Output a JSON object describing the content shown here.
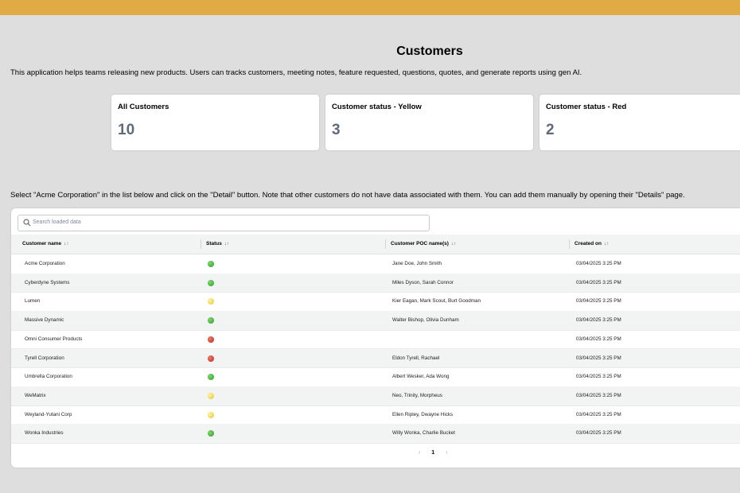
{
  "page": {
    "title": "Customers",
    "intro": "This application helps teams releasing new products. Users can tracks customers, meeting notes, feature requested, questions, quotes, and generate reports using gen AI.",
    "instructions": "Select \"Acme Corporation\" in the list below and click on the \"Detail\" button. Note that other customers do not have data associated with them. You can add them manually by opening their \"Details\" page."
  },
  "stats": [
    {
      "label": "All Customers",
      "value": "10"
    },
    {
      "label": "Customer status - Yellow",
      "value": "3"
    },
    {
      "label": "Customer status - Red",
      "value": "2"
    }
  ],
  "search": {
    "placeholder": "Search loaded data"
  },
  "table": {
    "columns": [
      {
        "label": "Customer name",
        "sort_icon": "↓↑"
      },
      {
        "label": "Status",
        "sort_icon": "↓↑"
      },
      {
        "label": "Customer POC name(s)",
        "sort_icon": "↓↑"
      },
      {
        "label": "Created on",
        "sort_icon": "↓↑"
      }
    ],
    "rows": [
      {
        "name": "Acme Corporation",
        "status": "green",
        "poc": "Jane Doe, John Smith",
        "created": "03/04/2025 3:25 PM"
      },
      {
        "name": "Cyberdyne Systems",
        "status": "green",
        "poc": "Miles Dyson, Sarah Connor",
        "created": "03/04/2025 3:25 PM"
      },
      {
        "name": "Lumen",
        "status": "yellow",
        "poc": "Kier Eagan, Mark Scout, Burt Goodman",
        "created": "03/04/2025 3:25 PM"
      },
      {
        "name": "Massive Dynamic",
        "status": "green",
        "poc": "Walter Bishop, Olivia Dunham",
        "created": "03/04/2025 3:25 PM"
      },
      {
        "name": "Omni Consumer Products",
        "status": "red",
        "poc": "",
        "created": "03/04/2025 3:25 PM"
      },
      {
        "name": "Tyrell Corporation",
        "status": "red",
        "poc": "Eldon Tyrell, Rachael",
        "created": "03/04/2025 3:25 PM"
      },
      {
        "name": "Umbrella Corporation",
        "status": "green",
        "poc": "Albert Wesker, Ada Wong",
        "created": "03/04/2025 3:25 PM"
      },
      {
        "name": "WeMatrix",
        "status": "yellow",
        "poc": "Neo, Trinity, Morpheus",
        "created": "03/04/2025 3:25 PM"
      },
      {
        "name": "Weyland-Yutani Corp",
        "status": "yellow",
        "poc": "Ellen Ripley, Dwayne Hicks",
        "created": "03/04/2025 3:25 PM"
      },
      {
        "name": "Wonka Industries",
        "status": "green",
        "poc": "Willy Wonka, Charlie Bucket",
        "created": "03/04/2025 3:25 PM"
      }
    ]
  },
  "pagination": {
    "prev": "‹",
    "current": "1",
    "next": "›"
  },
  "colors": {
    "topbar": "#e0ab44",
    "background": "#dedede",
    "stat_value": "#5f6b7a"
  }
}
